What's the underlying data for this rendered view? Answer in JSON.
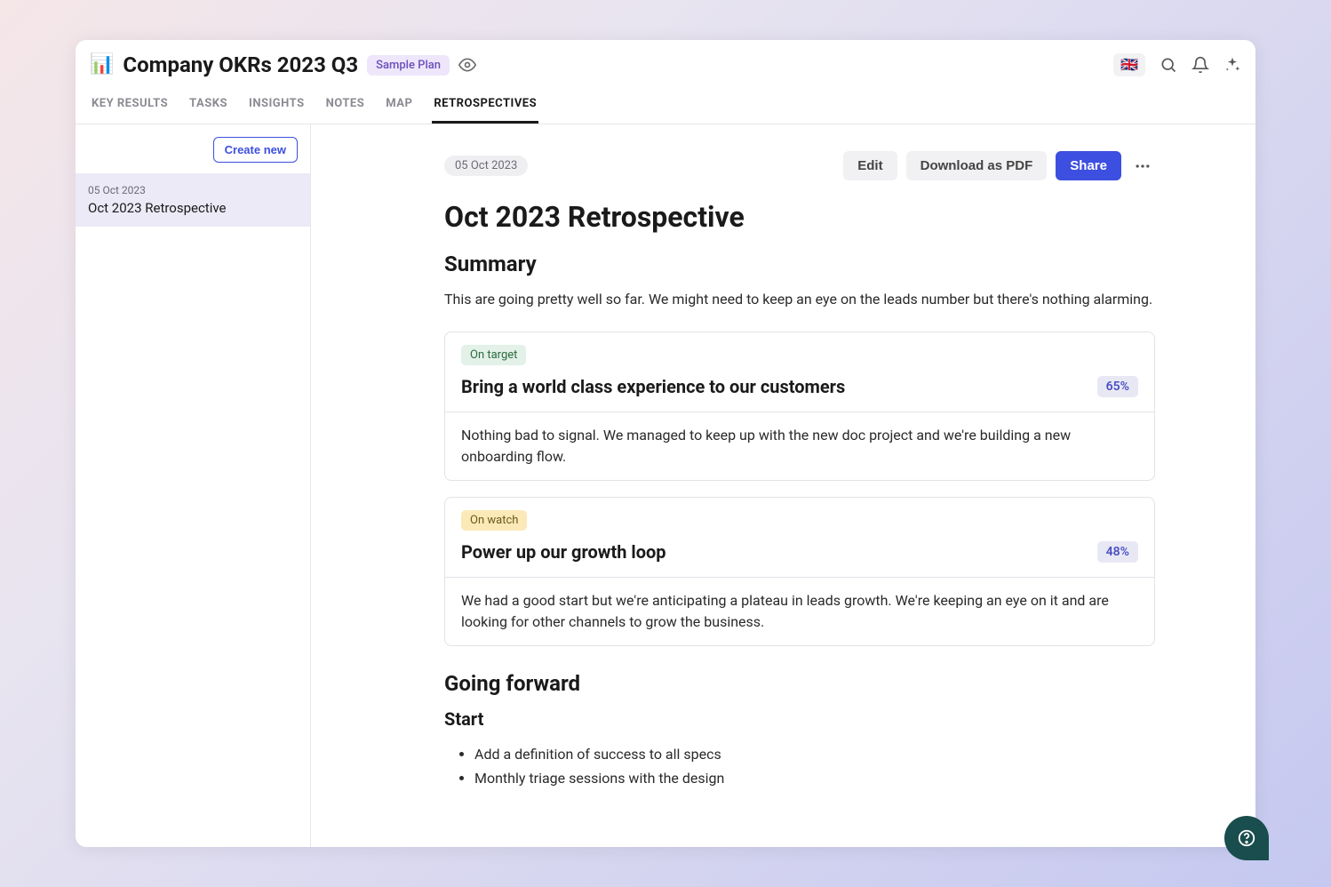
{
  "header": {
    "icon": "📊",
    "title": "Company OKRs 2023 Q3",
    "sample_label": "Sample Plan",
    "flag": "🇬🇧"
  },
  "tabs": [
    {
      "label": "KEY RESULTS",
      "active": false
    },
    {
      "label": "TASKS",
      "active": false
    },
    {
      "label": "INSIGHTS",
      "active": false
    },
    {
      "label": "NOTES",
      "active": false
    },
    {
      "label": "MAP",
      "active": false
    },
    {
      "label": "RETROSPECTIVES",
      "active": true
    }
  ],
  "sidebar": {
    "create_label": "Create new",
    "items": [
      {
        "date": "05 Oct 2023",
        "title": "Oct 2023 Retrospective"
      }
    ]
  },
  "actions": {
    "date": "05 Oct 2023",
    "edit": "Edit",
    "download": "Download as PDF",
    "share": "Share"
  },
  "retro": {
    "title": "Oct 2023 Retrospective",
    "summary_heading": "Summary",
    "summary_text": "This are going pretty well so far. We might need to keep an eye on the leads number but there's nothing alarming.",
    "cards": [
      {
        "status_label": "On target",
        "status_class": "status-on-target",
        "title": "Bring a world class experience to our customers",
        "percent": "65%",
        "body": "Nothing bad to signal. We managed to keep up with the new doc project and we're building a new onboarding flow."
      },
      {
        "status_label": "On watch",
        "status_class": "status-on-watch",
        "title": "Power up our growth loop",
        "percent": "48%",
        "body": "We had a good start but we're anticipating a plateau in leads growth. We're keeping an eye on it and are looking for other channels to grow the business."
      }
    ],
    "forward_heading": "Going forward",
    "start_heading": "Start",
    "start_items": [
      "Add a definition of success to all specs",
      "Monthly triage sessions with the design"
    ]
  }
}
